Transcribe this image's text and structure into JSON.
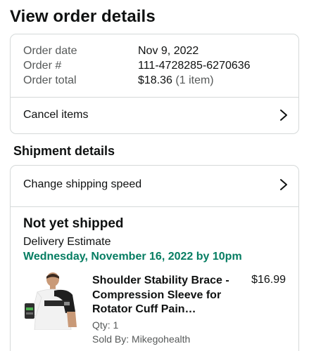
{
  "page": {
    "title": "View order details"
  },
  "order_summary": {
    "rows": [
      {
        "label": "Order date",
        "value": "Nov 9, 2022"
      },
      {
        "label": "Order #",
        "value": "111-4728285-6270636"
      },
      {
        "label": "Order total",
        "value": "$18.36",
        "value_extra": "(1 item)"
      }
    ],
    "cancel_label": "Cancel items"
  },
  "shipment": {
    "section_title": "Shipment details",
    "change_speed_label": "Change shipping speed",
    "status": "Not yet shipped",
    "delivery_label": "Delivery Estimate",
    "delivery_date": "Wednesday, November 16, 2022 by 10pm",
    "item": {
      "title": "Shoulder Stability Brace - Compression Sleeve for Rotator Cuff Pain…",
      "price": "$16.99",
      "qty": "Qty: 1",
      "seller": "Sold By: Mikegohealth"
    }
  },
  "colors": {
    "accent_green": "#067d62",
    "border": "#d5d9d9",
    "muted_text": "#565959",
    "primary_text": "#0f1111"
  },
  "icons": {
    "chevron": "chevron-right-icon"
  }
}
